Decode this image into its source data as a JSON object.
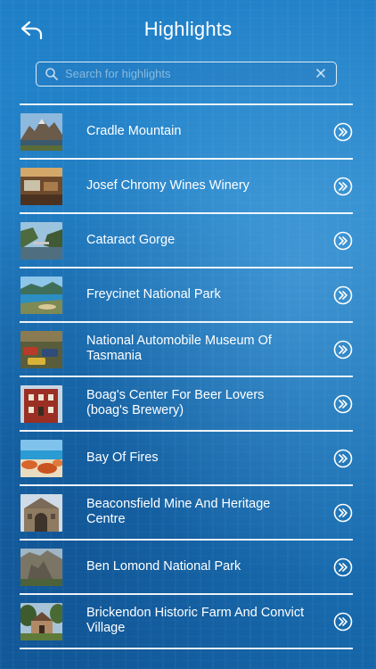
{
  "header": {
    "title": "Highlights",
    "back_icon": "back-arrow-icon"
  },
  "search": {
    "placeholder": "Search for highlights",
    "value": "",
    "search_icon": "search-icon",
    "clear_icon": "close-icon"
  },
  "colors": {
    "background_top": "#1e7fc7",
    "background_bottom": "#1565a8",
    "text": "#ffffff",
    "divider": "#ffffff"
  },
  "list": {
    "items": [
      {
        "label": "Cradle Mountain",
        "thumb_icon": "mountain-lake-photo"
      },
      {
        "label": "Josef Chromy Wines Winery",
        "thumb_icon": "winery-interior-photo"
      },
      {
        "label": "Cataract Gorge",
        "thumb_icon": "gorge-photo"
      },
      {
        "label": "Freycinet National Park",
        "thumb_icon": "coastal-bay-photo"
      },
      {
        "label": "National Automobile Museum Of Tasmania",
        "thumb_icon": "car-museum-photo"
      },
      {
        "label": "Boag's Center For Beer Lovers (boag's Brewery)",
        "thumb_icon": "brewery-building-photo"
      },
      {
        "label": "Bay Of Fires",
        "thumb_icon": "beach-rocks-photo"
      },
      {
        "label": "Beaconsfield Mine And Heritage Centre",
        "thumb_icon": "mine-building-photo"
      },
      {
        "label": "Ben Lomond National Park",
        "thumb_icon": "cliff-photo"
      },
      {
        "label": "Brickendon Historic Farm And Convict Village",
        "thumb_icon": "farm-house-photo"
      }
    ],
    "chevron_icon": "chevron-circle-right-icon"
  }
}
